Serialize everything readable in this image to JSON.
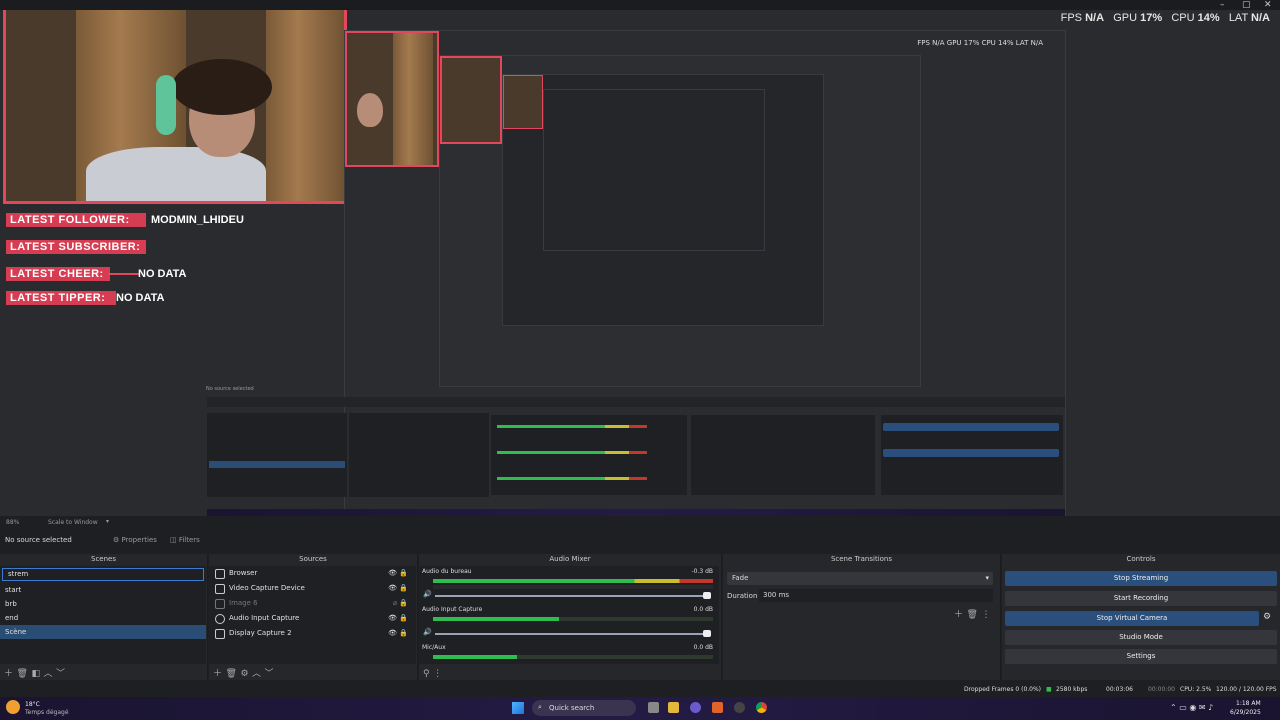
{
  "stats": {
    "fps_label": "FPS",
    "fps": "N/A",
    "gpu_label": "GPU",
    "gpu": "17%",
    "cpu_label": "CPU",
    "cpu": "14%",
    "lat_label": "LAT",
    "lat": "N/A"
  },
  "alerts": [
    {
      "label": "LATEST FOLLOWER:",
      "value": "MODMIN_LHIDEU"
    },
    {
      "label": "LATEST SUBSCRIBER:",
      "value": ""
    },
    {
      "label": "LATEST CHEER:",
      "value": "NO DATA"
    },
    {
      "label": "LATEST TIPPER:",
      "value": "NO DATA"
    }
  ],
  "zoombar": {
    "zoom": "88%",
    "scale": "Scale to Window"
  },
  "source_toolbar": {
    "no_source": "No source selected",
    "properties": "Properties",
    "filters": "Filters"
  },
  "docks": {
    "scenes": "Scenes",
    "sources": "Sources",
    "mixer": "Audio Mixer",
    "transitions": "Scene Transitions",
    "controls": "Controls"
  },
  "scenes": [
    "strem",
    "start",
    "brb",
    "end",
    "Scène"
  ],
  "sources": [
    "Browser",
    "Video Capture Device",
    "Image 6",
    "Audio Input Capture",
    "Display Capture 2"
  ],
  "mixer": [
    {
      "name": "Audio du bureau",
      "db": "-0.3 dB"
    },
    {
      "name": "Audio Input Capture",
      "db": "0.0 dB"
    },
    {
      "name": "Mic/Aux",
      "db": "0.0 dB"
    }
  ],
  "mixer_scale": [
    "-60",
    "-55",
    "-50",
    "-45",
    "-40",
    "-35",
    "-30",
    "-25",
    "-20",
    "-15",
    "-10",
    "-5",
    "0"
  ],
  "transitions": {
    "type": "Fade",
    "duration_label": "Duration",
    "duration": "300 ms"
  },
  "controls": [
    "Stop Streaming",
    "Start Recording",
    "Stop Virtual Camera",
    "Studio Mode",
    "Settings"
  ],
  "status": {
    "dropped": "Dropped Frames 0 (0.0%)",
    "kbps": "2580 kbps",
    "stream_time": "00:03:06",
    "rec_time": "00:00:00",
    "cpu": "CPU: 2.5%",
    "fps": "120.00 / 120.00 FPS"
  },
  "taskbar": {
    "weather_temp": "18°C",
    "weather_desc": "Temps dégagé",
    "search": "Quick search",
    "time": "1:18 AM",
    "date": "6/29/2025"
  },
  "nested_stats": "FPS N/A  GPU 17%  CPU 14%  LAT N/A"
}
